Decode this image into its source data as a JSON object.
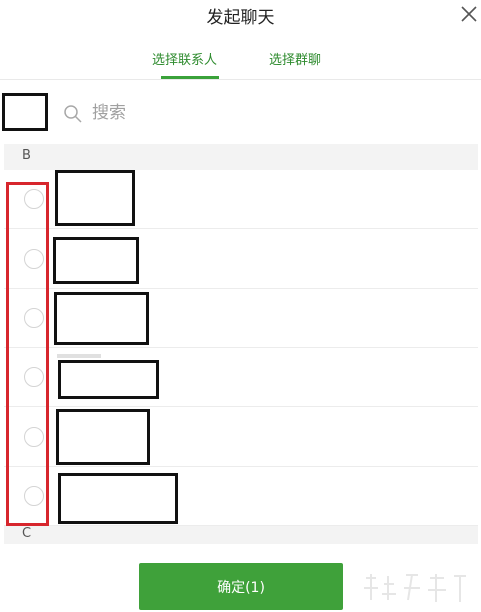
{
  "dialog": {
    "title": "发起聊天",
    "close_icon": "close-icon"
  },
  "tabs": [
    {
      "label": "选择联系人",
      "active": true
    },
    {
      "label": "选择群聊",
      "active": false
    }
  ],
  "search": {
    "placeholder": "搜索",
    "icon": "search-icon"
  },
  "sections": [
    {
      "letter": "B",
      "contacts_visible": 6
    },
    {
      "letter": "C"
    }
  ],
  "confirm": {
    "label": "确定(1)"
  },
  "colors": {
    "accent_green": "#3fa13a",
    "tab_text_green": "#2e8b2e",
    "highlight_red": "#d7262d"
  }
}
